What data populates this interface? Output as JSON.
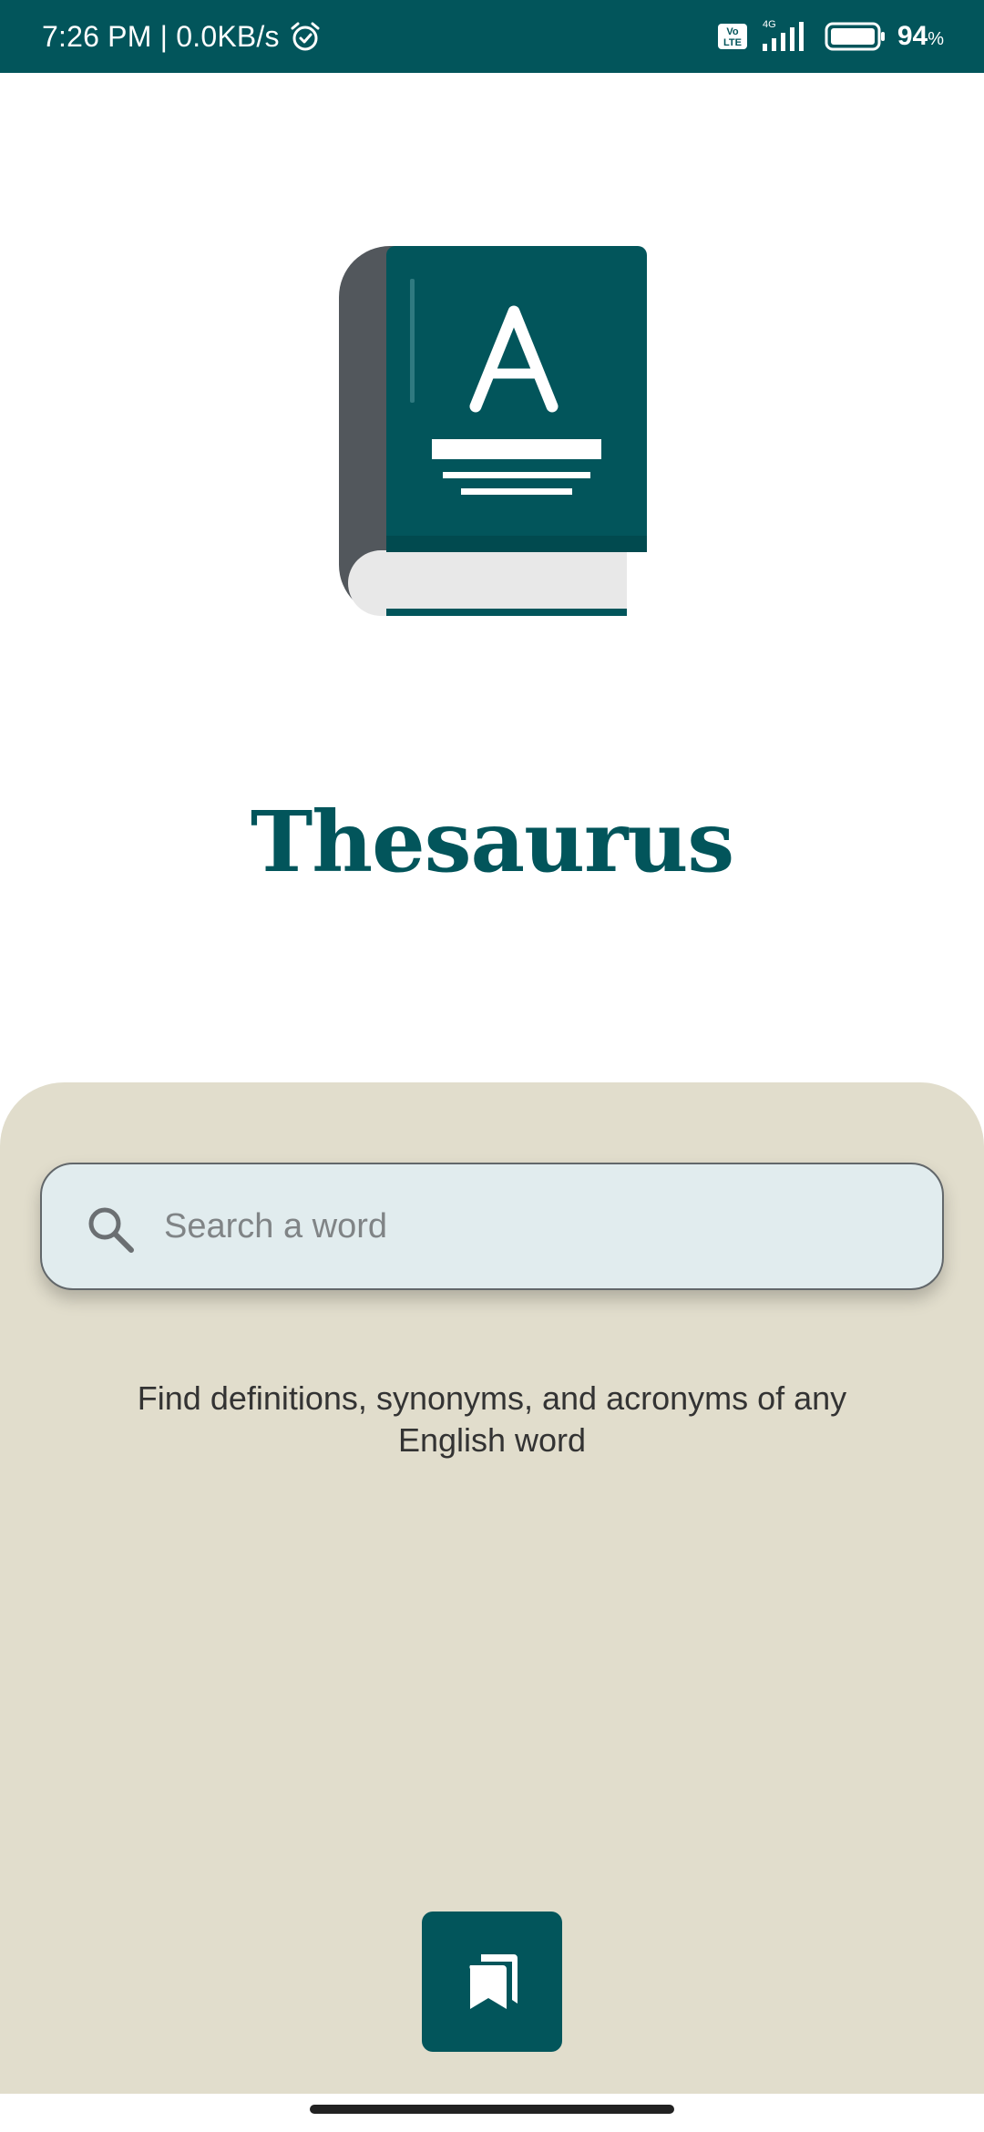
{
  "status_bar": {
    "time_speed": "7:26 PM | 0.0KB/s",
    "network": "4G",
    "volte": "Vo LTE",
    "battery_percent": "94",
    "battery_unit": "%"
  },
  "app": {
    "title": "Thesaurus",
    "logo_letter": "A"
  },
  "search": {
    "placeholder": "Search a word",
    "value": ""
  },
  "tagline": "Find definitions, synonyms, and acronyms of any English word",
  "icons": {
    "alarm": "alarm-icon",
    "search": "search-icon",
    "bookmarks": "bookmarks-icon",
    "book_logo": "book-logo-icon"
  },
  "colors": {
    "primary": "#02555b",
    "panel": "#e1ddcc",
    "search_bg": "#e1ecee",
    "text": "#333333"
  }
}
